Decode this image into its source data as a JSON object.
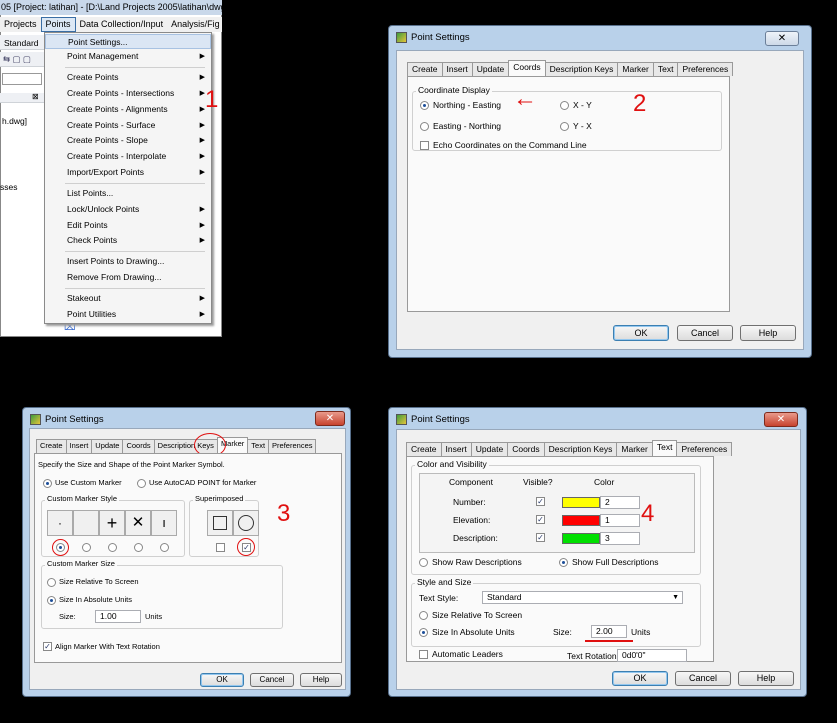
{
  "panel1": {
    "title": "05 [Project: latihan] - [D:\\Land Projects 2005\\latihan\\dwg\\",
    "menubar": [
      "Projects",
      "Points",
      "Data Collection/Input",
      "Analysis/Fig"
    ],
    "left_texts": {
      "standard": "Standard",
      "dwg": "h.dwg]",
      "sses": "sses"
    },
    "menu_items": [
      {
        "label": "Point Settings...",
        "arrow": ""
      },
      {
        "label": "Point Management",
        "arrow": "▶"
      },
      {
        "label": "Create Points",
        "arrow": "▶"
      },
      {
        "label": "Create Points - Intersections",
        "arrow": "▶"
      },
      {
        "label": "Create Points - Alignments",
        "arrow": "▶"
      },
      {
        "label": "Create Points - Surface",
        "arrow": "▶"
      },
      {
        "label": "Create Points - Slope",
        "arrow": "▶"
      },
      {
        "label": "Create Points - Interpolate",
        "arrow": "▶"
      },
      {
        "label": "Import/Export Points",
        "arrow": "▶"
      },
      {
        "label": "List Points...",
        "arrow": ""
      },
      {
        "label": "Lock/Unlock Points",
        "arrow": "▶"
      },
      {
        "label": "Edit Points",
        "arrow": "▶"
      },
      {
        "label": "Check Points",
        "arrow": "▶"
      },
      {
        "label": "Insert Points to Drawing...",
        "arrow": ""
      },
      {
        "label": "Remove From Drawing...",
        "arrow": ""
      },
      {
        "label": "Stakeout",
        "arrow": "▶"
      },
      {
        "label": "Point Utilities",
        "arrow": "▶"
      }
    ],
    "number": "1"
  },
  "dialog_title": "Point Settings",
  "close_glyph": "✕",
  "tabs": [
    "Create",
    "Insert",
    "Update",
    "Coords",
    "Description Keys",
    "Marker",
    "Text",
    "Preferences"
  ],
  "buttons": {
    "ok": "OK",
    "cancel": "Cancel",
    "help": "Help"
  },
  "panel2": {
    "group_label": "Coordinate Display",
    "opt_ne": "Northing - Easting",
    "opt_en": "Easting - Northing",
    "opt_xy": "X - Y",
    "opt_yx": "Y - X",
    "echo": "Echo Coordinates on the Command Line",
    "arrow": "←",
    "number": "2"
  },
  "panel3": {
    "intro": "Specify the Size and Shape of the Point Marker Symbol.",
    "use_custom": "Use Custom Marker",
    "use_autocad": "Use AutoCAD POINT for Marker",
    "custom_style": "Custom Marker Style",
    "superimposed": "Superimposed",
    "size_group": "Custom Marker Size",
    "rel_screen": "Size Relative To Screen",
    "abs_units": "Size In Absolute Units",
    "size_label": "Size:",
    "size_value": "1.00",
    "units": "Units",
    "align": "Align Marker With Text Rotation",
    "markers": [
      "·",
      "",
      "+",
      "✕",
      "ı"
    ],
    "check_glyph": "✓",
    "number": "3"
  },
  "panel4": {
    "cv_group": "Color and Visibility",
    "hdr_component": "Component",
    "hdr_visible": "Visible?",
    "hdr_color": "Color",
    "rows": [
      {
        "name": "Number:",
        "color": "#ffff00",
        "index": "2"
      },
      {
        "name": "Elevation:",
        "color": "#ff0000",
        "index": "1"
      },
      {
        "name": "Description:",
        "color": "#00e000",
        "index": "3"
      }
    ],
    "raw_desc": "Show Raw Descriptions",
    "full_desc": "Show Full Descriptions",
    "ss_group": "Style and Size",
    "text_style_label": "Text Style:",
    "text_style_value": "Standard",
    "rel_screen": "Size Relative To Screen",
    "abs_units": "Size In Absolute Units",
    "size_label": "Size:",
    "size_value": "2.00",
    "units": "Units",
    "auto_leaders": "Automatic Leaders",
    "rotation_label": "Text Rotation:",
    "rotation_value": "0d0'0\"",
    "dropdown_glyph": "▼",
    "number": "4"
  }
}
